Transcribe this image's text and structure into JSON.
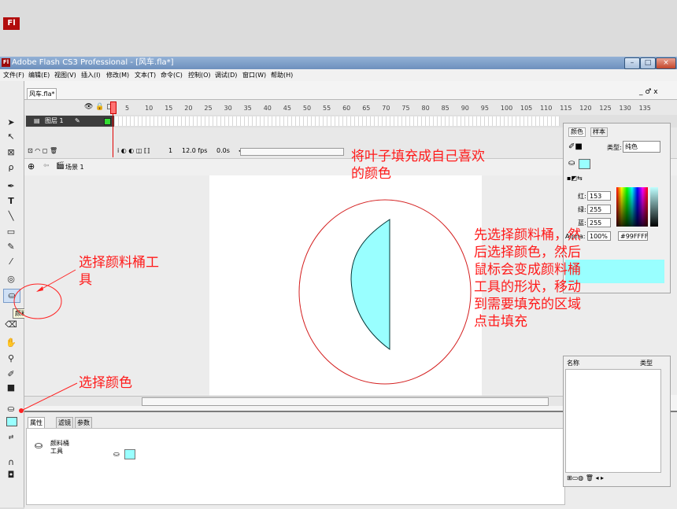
{
  "window": {
    "app_title": "Adobe Flash CS3 Professional - [风车.fla*]",
    "logo": "Fl",
    "controls": [
      "minimize-icon",
      "maximize-icon",
      "close-icon"
    ]
  },
  "menu": [
    "文件(F)",
    "编辑(E)",
    "视图(V)",
    "插入(I)",
    "修改(M)",
    "文本(T)",
    "命令(C)",
    "控制(O)",
    "调试(D)",
    "窗口(W)",
    "帮助(H)"
  ],
  "document": {
    "tab": "风车.fla*",
    "window_controls": "_ ♂ x"
  },
  "timeline": {
    "frame_numbers": [
      "5",
      "10",
      "15",
      "20",
      "25",
      "30",
      "35",
      "40",
      "45",
      "50",
      "55",
      "60",
      "65",
      "70",
      "75",
      "80",
      "85",
      "90",
      "95",
      "100",
      "105",
      "110",
      "115",
      "120",
      "125",
      "130",
      "135"
    ],
    "layer": "图层 1",
    "current_frame": "1",
    "fps": "12.0 fps",
    "time": "0.0s"
  },
  "scene": {
    "label": "场景 1"
  },
  "tooltip": "颜料桶工具 (K)",
  "properties_panel": {
    "tabs": [
      "属性",
      "滤镜",
      "参数"
    ],
    "tool_name": "颜料桶\n工具",
    "fill_color": "#99FFFF"
  },
  "color_panel": {
    "tabs": [
      "颜色",
      "样本"
    ],
    "type_label": "类型:",
    "type_value": "纯色",
    "red_label": "红:",
    "red": "153",
    "green_label": "绿:",
    "green": "255",
    "blue_label": "蓝:",
    "blue": "255",
    "alpha_label": "Alpha:",
    "alpha": "100%",
    "hex": "#99FFFF"
  },
  "library_panel": {
    "name_header": "名称",
    "type_header": "类型"
  },
  "annotations": {
    "fill_leaf": "将叶子填充成自己喜欢\n的颜色",
    "select_bucket": "选择颜料桶工\n具",
    "select_color": "选择颜色",
    "instructions": "先选择颜料桶，然\n后选择颜色，然后\n鼠标会变成颜料桶\n工具的形状，移动\n到需要填充的区域\n点击填充"
  },
  "colors": {
    "fill": "#99ffff",
    "annotation": "#ff1a1a",
    "outline_circle": "#d42020"
  }
}
